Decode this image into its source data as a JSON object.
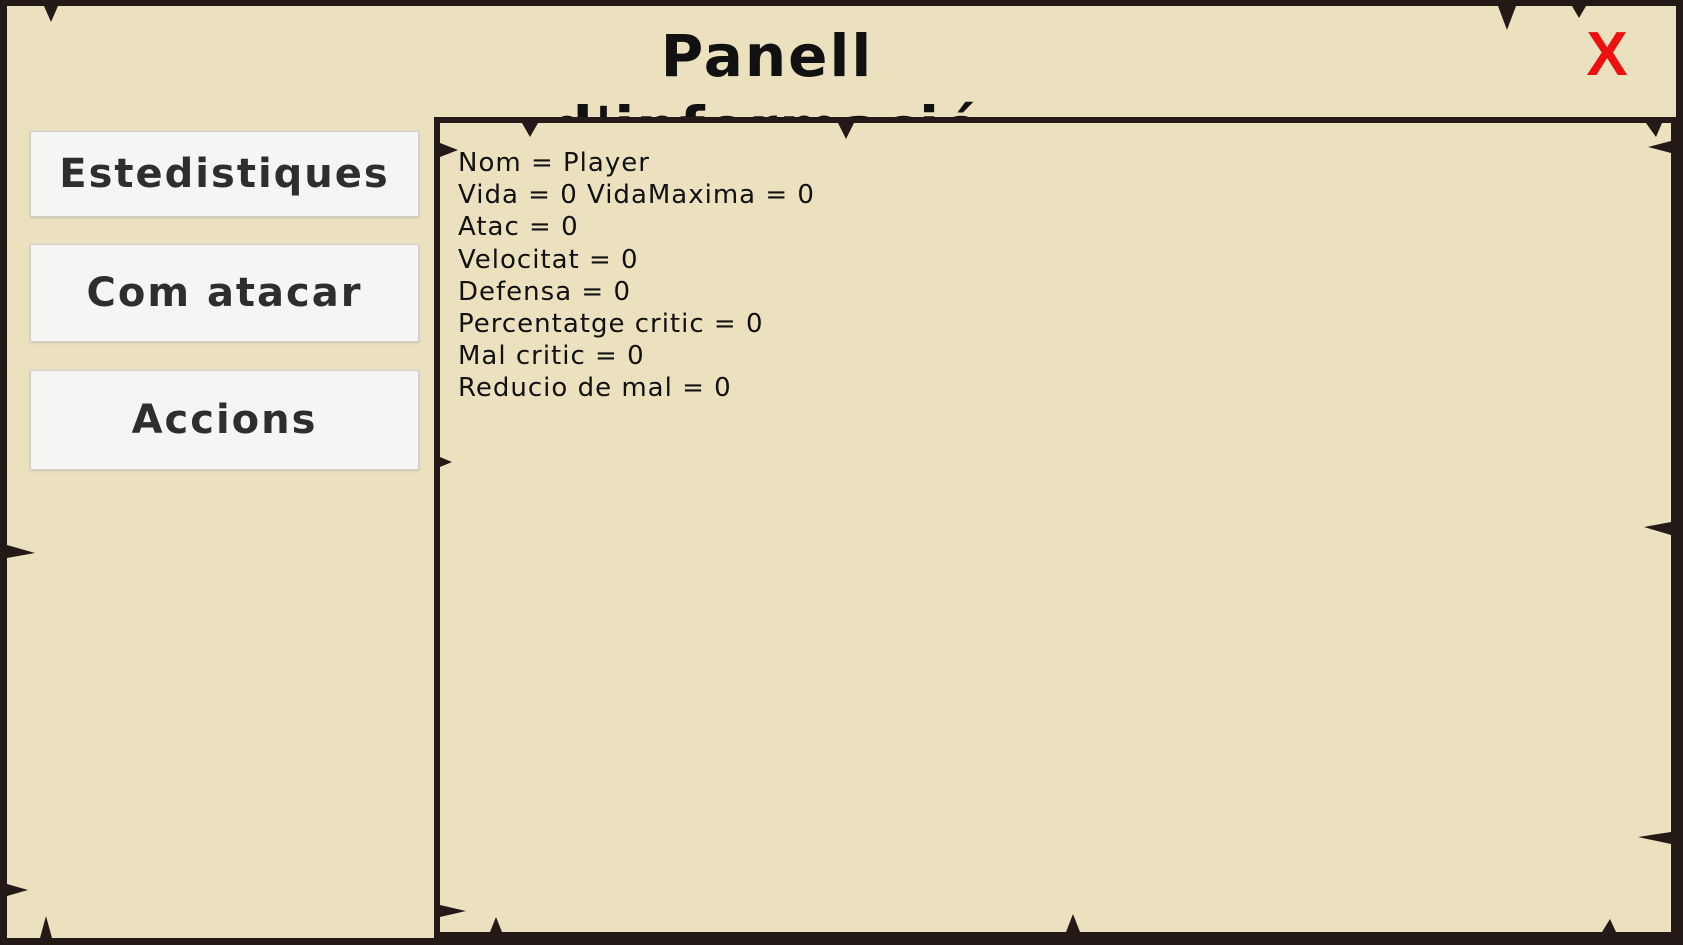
{
  "panel": {
    "title": "Panell d'informació",
    "close_label": "X"
  },
  "menu": {
    "items": [
      {
        "label": "Estedistiques"
      },
      {
        "label": "Com atacar"
      },
      {
        "label": "Accions"
      }
    ]
  },
  "info": {
    "lines": [
      "Nom = Player",
      "Vida = 0 VidaMaxima = 0",
      "Atac = 0",
      "Velocitat = 0",
      "Defensa = 0",
      "Percentatge critic = 0",
      "Mal critic = 0",
      "Reducio de mal = 0"
    ]
  },
  "colors": {
    "background": "#ebe1bf",
    "border": "#231a17",
    "close": "#ee1010"
  }
}
